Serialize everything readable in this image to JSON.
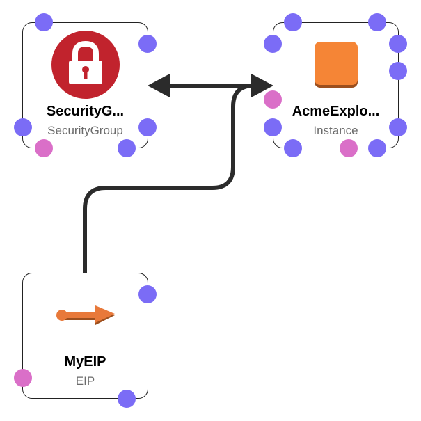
{
  "colors": {
    "port_default": "#7B6CF6",
    "port_active": "#DA6FC8",
    "connector": "#2B2B2B",
    "security_icon_bg": "#C1232D",
    "instance_icon": "#F58536",
    "eip_icon": "#E8793A"
  },
  "nodes": {
    "security_group": {
      "title": "SecurityG...",
      "type": "SecurityGroup",
      "icon": "padlock-icon"
    },
    "instance": {
      "title": "AcmeExplo...",
      "type": "Instance",
      "icon": "instance-square-icon"
    },
    "eip": {
      "title": "MyEIP",
      "type": "EIP",
      "icon": "elastic-ip-arrow-icon"
    }
  },
  "connections": [
    {
      "from": "security_group",
      "to": "instance",
      "arrows": "both"
    },
    {
      "from": "eip",
      "to": "connector-junction",
      "arrows": "none"
    }
  ]
}
